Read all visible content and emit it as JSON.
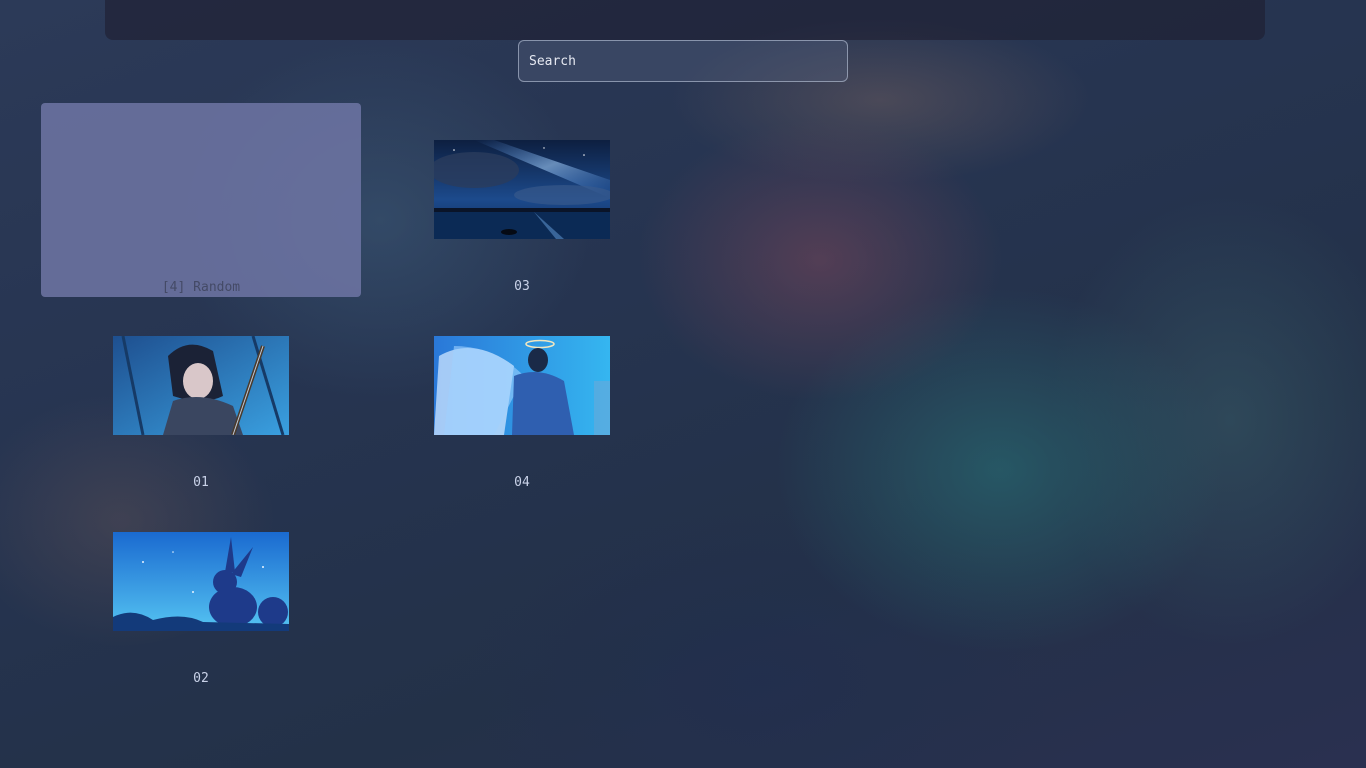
{
  "search": {
    "value": "",
    "placeholder": "Search"
  },
  "items": [
    {
      "label": "[4] Random",
      "selected": true
    },
    {
      "label": "03",
      "image": "night-sky-lake-thumbnail"
    },
    {
      "label": "01",
      "image": "girl-with-sword-thumbnail"
    },
    {
      "label": "04",
      "image": "angel-with-halo-thumbnail"
    },
    {
      "label": "02",
      "image": "rabbit-silhouette-thumbnail"
    }
  ]
}
